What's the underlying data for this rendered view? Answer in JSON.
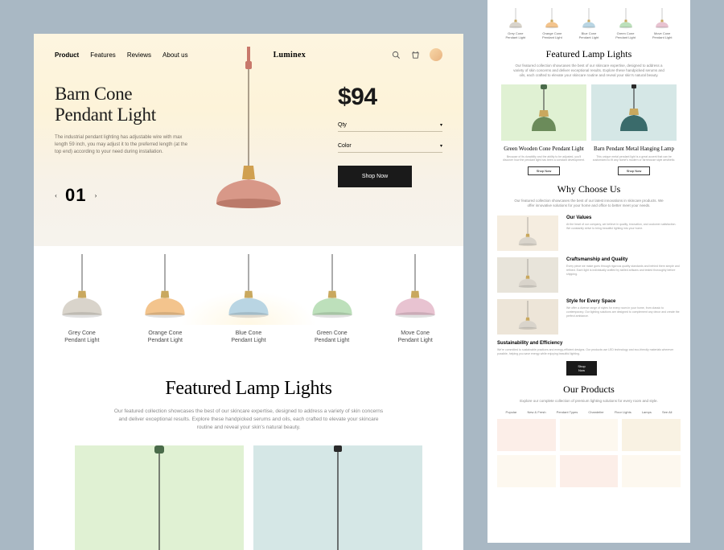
{
  "nav": {
    "items": [
      "Product",
      "Features",
      "Reviews",
      "About us"
    ],
    "brand": "Luminex"
  },
  "hero": {
    "title_line1": "Barn Cone",
    "title_line2": "Pendant Light",
    "desc": "The industrial pendant lighting has adjustable wire with max length 59 inch, you may adjust it to the preferred length (at the top end) according to your need during installation.",
    "counter": "01",
    "price": "$94",
    "qty_label": "Qty",
    "color_label": "Color",
    "shop_label": "Shop Now"
  },
  "products": [
    {
      "name": "Grey Cone\nPendant Light",
      "shade": "#d9d4cb",
      "cap": "#c9a85e"
    },
    {
      "name": "Orange Cone\nPendant Light",
      "shade": "#f3c48d",
      "cap": "#c9a85e"
    },
    {
      "name": "Blue Cone\nPendant Light",
      "shade": "#b9d5e3",
      "cap": "#c9a85e"
    },
    {
      "name": "Green Cone\nPendant Light",
      "shade": "#bde0bb",
      "cap": "#c9a85e"
    },
    {
      "name": "Move Cone\nPendant Light",
      "shade": "#e8c3d1",
      "cap": "#c9a85e"
    }
  ],
  "featured": {
    "title": "Featured Lamp Lights",
    "desc": "Our featured collection showcases the best of our skincare expertise, designed to address a variety of skin concerns and deliver exceptional results. Explore these handpicked serums and oils, each crafted to elevate your skincare routine and reveal your skin's natural beauty."
  },
  "side": {
    "featured_title": "Featured Lamp Lights",
    "cards": [
      {
        "title": "Green Wooden Cone Pendant Light",
        "desc": "Because of its durability and the ability to be adjusted, you'll discover how the pendant light has been a constant development.",
        "btn": "Shop Now"
      },
      {
        "title": "Barn Pendant Metal Hanging Lamp",
        "desc": "This unique metal pendant light is a great accent that can be customized to fit any home's modern or farmhouse style aesthetic.",
        "btn": "Shop Now"
      }
    ],
    "why_title": "Why Choose Us",
    "why_desc": "Our featured collection showcases the best of our latest innovations in skincare products. We offer innovative solutions for your home and office to better meet your needs.",
    "why_items": [
      {
        "title": "Our Values",
        "desc": "At the heart of our company, we believe in quality, innovation, and customer satisfaction. We constantly strive to bring beautiful lighting into your home."
      },
      {
        "title": "Craftsmanship and Quality",
        "desc": "Every piece we make goes through rigorous quality standards and behind them simple and refined. Each light is individually crafted by skilled artisans and tested thoroughly before shipping."
      },
      {
        "title": "Style for Every Space",
        "desc": "We offer a diverse range of styles for every room in your home, from classic to contemporary. Our lighting solutions are designed to complement any decor and create the perfect ambiance."
      },
      {
        "title": "Sustainability and Efficiency",
        "desc": "We're committed to sustainable practices and energy-efficient designs. Our products use LED technology and eco-friendly materials wherever possible, helping you save energy while enjoying beautiful lighting."
      }
    ],
    "shop_label": "Shop Now",
    "products_title": "Our Products",
    "products_desc": "Explore our complete collection of premium lighting solutions for every room and style.",
    "filters": [
      "Popular",
      "New & Fresh",
      "Pendant Types",
      "Chandelier",
      "Floor Lights",
      "Lamps",
      "See All"
    ]
  }
}
